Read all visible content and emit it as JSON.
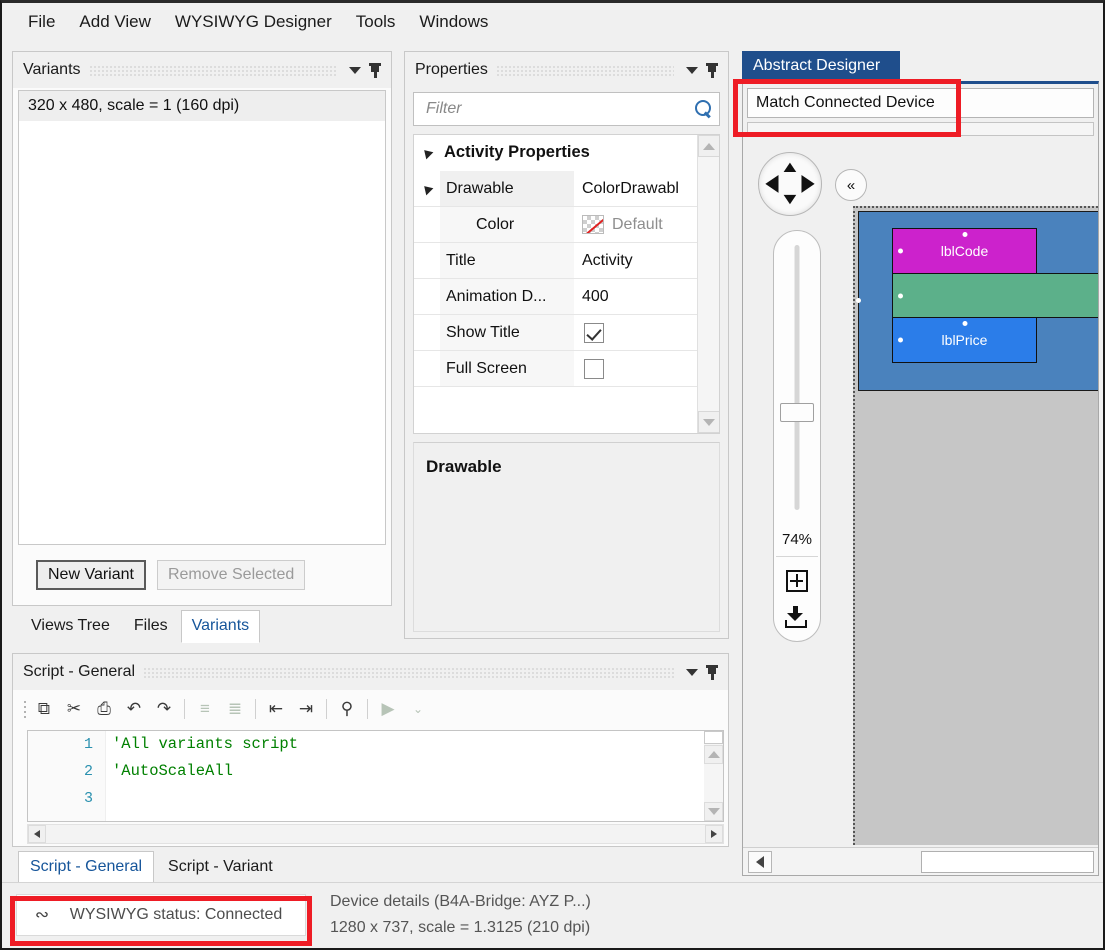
{
  "menu": {
    "items": [
      {
        "label": "File"
      },
      {
        "label": "Add View"
      },
      {
        "label": "WYSIWYG Designer"
      },
      {
        "label": "Tools"
      },
      {
        "label": "Windows"
      }
    ]
  },
  "variants": {
    "title": "Variants",
    "items": [
      "320 x 480, scale = 1 (160 dpi)"
    ],
    "new_button": "New Variant",
    "remove_button": "Remove Selected",
    "tabs": [
      {
        "label": "Views Tree",
        "active": false
      },
      {
        "label": "Files",
        "active": false
      },
      {
        "label": "Variants",
        "active": true
      }
    ]
  },
  "properties": {
    "title": "Properties",
    "filter_placeholder": "Filter",
    "filter_value": "",
    "group_title": "Activity Properties",
    "rows": [
      {
        "name": "Drawable",
        "value": "ColorDrawabl",
        "type": "dropdown",
        "expandable": true
      },
      {
        "name": "Color",
        "value": "Default",
        "type": "color",
        "indent": true
      },
      {
        "name": "Title",
        "value": "Activity",
        "type": "text"
      },
      {
        "name": "Animation D...",
        "value": "400",
        "type": "dropdown"
      },
      {
        "name": "Show Title",
        "value": "checked",
        "type": "checkbox"
      },
      {
        "name": "Full Screen",
        "value": "unchecked",
        "type": "checkbox"
      }
    ],
    "footer_title": "Drawable"
  },
  "designer": {
    "tab_label": "Abstract Designer",
    "device_selector": "Match Connected Device",
    "zoom_percent": "74%",
    "views": [
      {
        "name": "lblCode",
        "color": "#cc22cc",
        "label": "lblCode"
      },
      {
        "name": "panel",
        "color": "#5cb08a",
        "label": ""
      },
      {
        "name": "lblPrice",
        "color": "#2b7de9",
        "label": "lblPrice"
      }
    ],
    "root_color": "#4a82bd",
    "canvas_bg": "#c6c6c6"
  },
  "script": {
    "title": "Script - General",
    "toolbar": [
      {
        "name": "copy-icon",
        "glyph": "⧉",
        "enabled": true
      },
      {
        "name": "cut-icon",
        "glyph": "✂",
        "enabled": true
      },
      {
        "name": "paste-icon",
        "glyph": "⎙",
        "enabled": true
      },
      {
        "name": "undo-icon",
        "glyph": "↶",
        "enabled": true
      },
      {
        "name": "redo-icon",
        "glyph": "↷",
        "enabled": true
      },
      {
        "name": "comment-icon",
        "glyph": "≡",
        "enabled": false
      },
      {
        "name": "uncomment-icon",
        "glyph": "≣",
        "enabled": false
      },
      {
        "name": "outdent-icon",
        "glyph": "⇤",
        "enabled": true
      },
      {
        "name": "indent-icon",
        "glyph": "⇥",
        "enabled": true
      },
      {
        "name": "find-icon",
        "glyph": "⚲",
        "enabled": true
      },
      {
        "name": "run-icon",
        "glyph": "▶",
        "enabled": false
      },
      {
        "name": "overflow-icon",
        "glyph": "⌄",
        "enabled": true
      }
    ],
    "lines": [
      {
        "n": "1",
        "text": "'All variants script"
      },
      {
        "n": "2",
        "text": "'AutoScaleAll"
      },
      {
        "n": "3",
        "text": ""
      }
    ],
    "tabs": [
      {
        "label": "Script - General",
        "active": true
      },
      {
        "label": "Script - Variant",
        "active": false
      }
    ]
  },
  "status": {
    "connection_label": "WYSIWYG status: Connected",
    "device_line1": "Device details (B4A-Bridge: AYZ P...)",
    "device_line2": "1280 x 737, scale = 1.3125 (210 dpi)"
  },
  "highlight_color": "#ee1c25"
}
